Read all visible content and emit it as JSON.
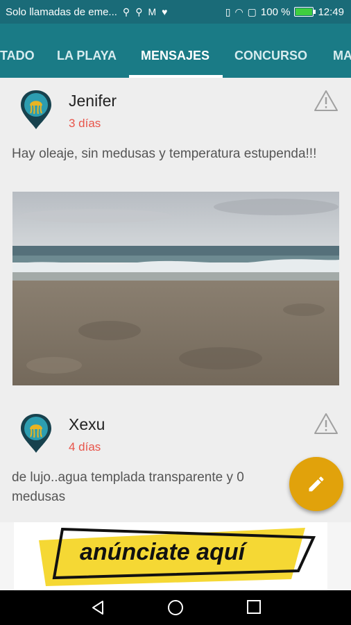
{
  "status_bar": {
    "carrier_text": "Solo llamadas de eme...",
    "battery_percent": "100 %",
    "time": "12:49"
  },
  "tabs": [
    {
      "label": "TADO"
    },
    {
      "label": "LA PLAYA"
    },
    {
      "label": "MENSAJES"
    },
    {
      "label": "CONCURSO"
    },
    {
      "label": "MA"
    }
  ],
  "active_tab": "MENSAJES",
  "posts": [
    {
      "user": "Jenifer",
      "time": "3 días",
      "text": "Hay oleaje, sin medusas y temperatura estupenda!!!"
    },
    {
      "user": "Xexu",
      "time": "4 días",
      "text": "de lujo..agua templada transparente y 0 medusas"
    }
  ],
  "ad": {
    "text": "anúnciate aquí"
  },
  "colors": {
    "toolbar": "#1a7b86",
    "accent_fab": "#e1a20b",
    "time_red": "#e8544a",
    "ad_yellow": "#f5d834"
  }
}
